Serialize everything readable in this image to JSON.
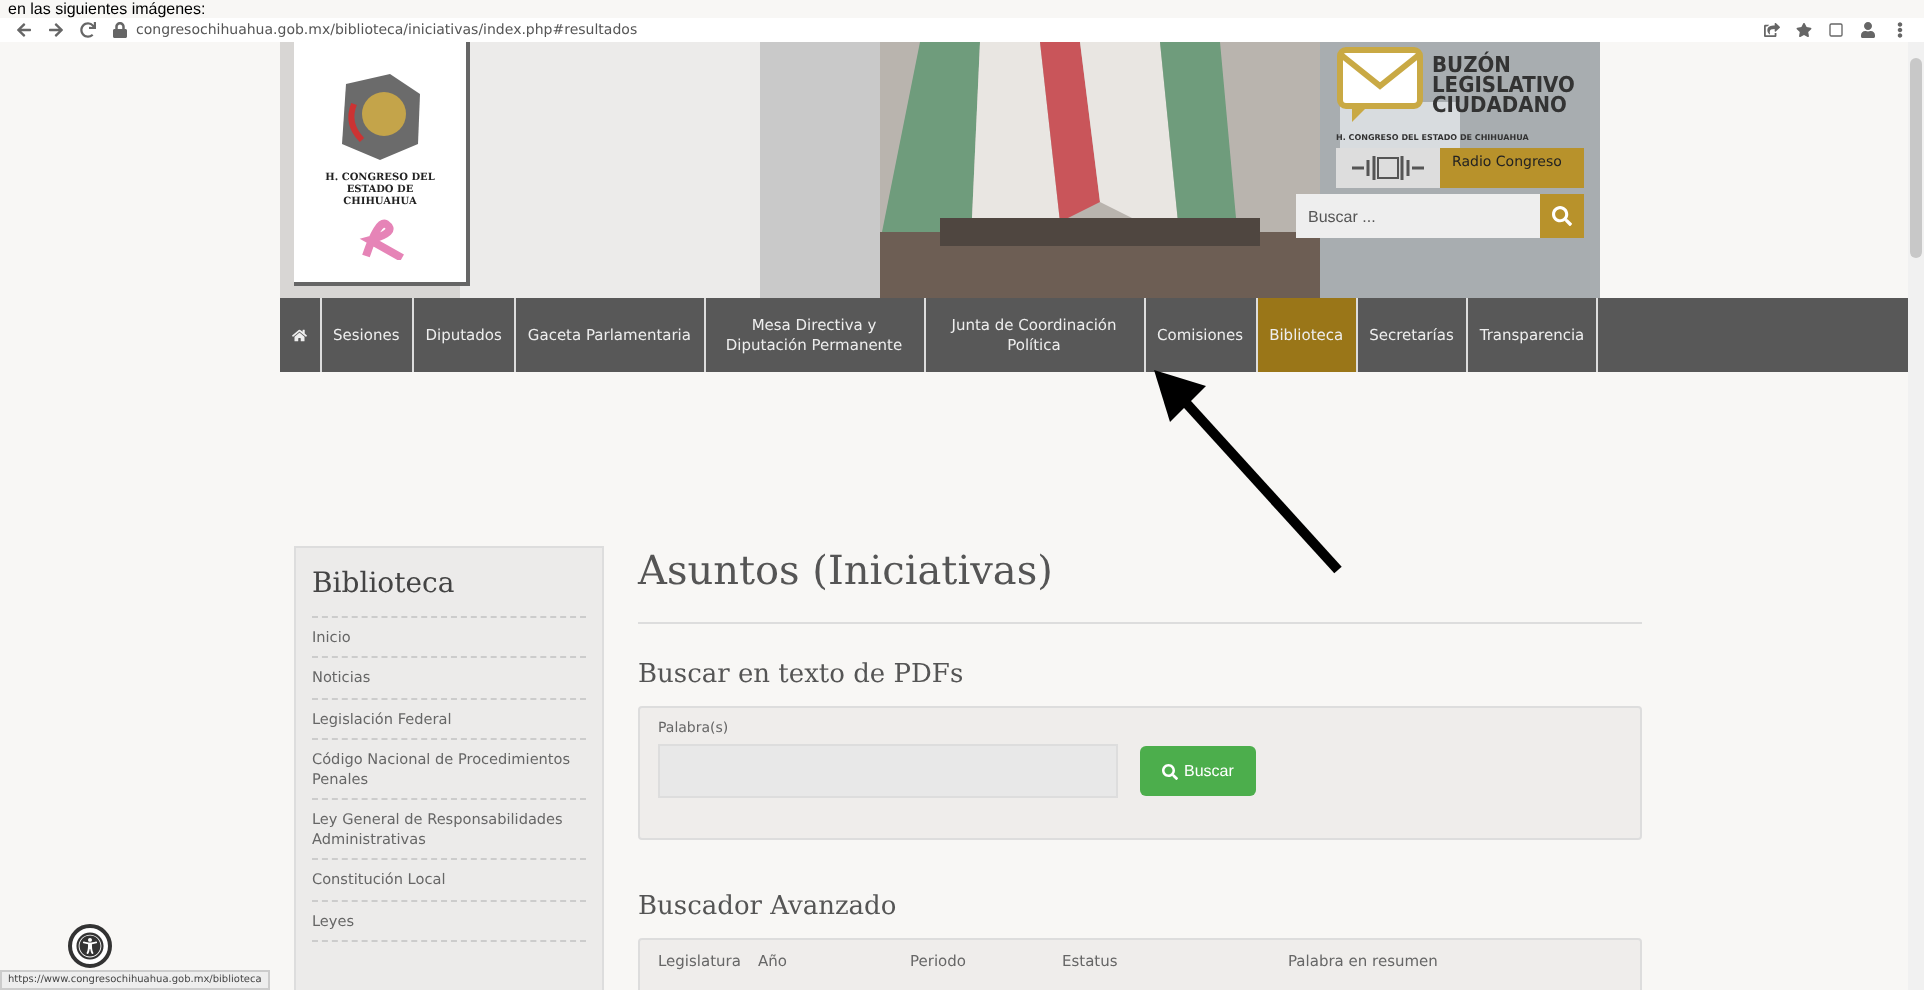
{
  "caption": "en las siguientes imágenes:",
  "browser": {
    "url": "congresochihuahua.gob.mx/biblioteca/iniciativas/index.php#resultados"
  },
  "header": {
    "logo_text": "H. CONGRESO DEL ESTADO DE CHIHUAHUA",
    "buzon_title": [
      "BUZÓN",
      "LEGISLATIVO",
      "CIUDADANO"
    ],
    "buzon_subtitle": "H. CONGRESO DEL ESTADO DE CHIHUAHUA",
    "radio_label": "Radio Congreso",
    "search": {
      "placeholder": "Buscar ..."
    }
  },
  "nav": [
    {
      "kind": "home",
      "selected": false
    },
    {
      "kind": "text",
      "label": "Sesiones",
      "selected": false
    },
    {
      "kind": "text",
      "label": "Diputados",
      "selected": false
    },
    {
      "kind": "text",
      "label": "Gaceta Parlamentaria",
      "selected": false
    },
    {
      "kind": "text",
      "label": "Mesa Directiva y Diputación Permanente",
      "selected": false
    },
    {
      "kind": "text",
      "label": "Junta de Coordinación Política",
      "selected": false
    },
    {
      "kind": "text",
      "label": "Comisiones",
      "selected": false
    },
    {
      "kind": "text",
      "label": "Biblioteca",
      "selected": true
    },
    {
      "kind": "text",
      "label": "Secretarías",
      "selected": false
    },
    {
      "kind": "text",
      "label": "Transparencia",
      "selected": false
    }
  ],
  "sidebar": {
    "title": "Biblioteca",
    "items": [
      "Inicio",
      "Noticias",
      "Legislación Federal",
      "Código Nacional de Procedimientos Penales",
      "Ley General de Responsabilidades Administrativas",
      "Constitución Local",
      "Leyes"
    ]
  },
  "main": {
    "title": "Asuntos (Iniciativas)",
    "pdf_search": {
      "heading": "Buscar en texto de PDFs",
      "label": "Palabra(s)",
      "button": "Buscar"
    },
    "advanced": {
      "heading": "Buscador Avanzado",
      "columns": [
        "Legislatura",
        "Año",
        "Periodo",
        "Estatus",
        "Palabra en resumen"
      ]
    }
  },
  "status_url": "https://www.congresochihuahua.gob.mx/biblioteca"
}
